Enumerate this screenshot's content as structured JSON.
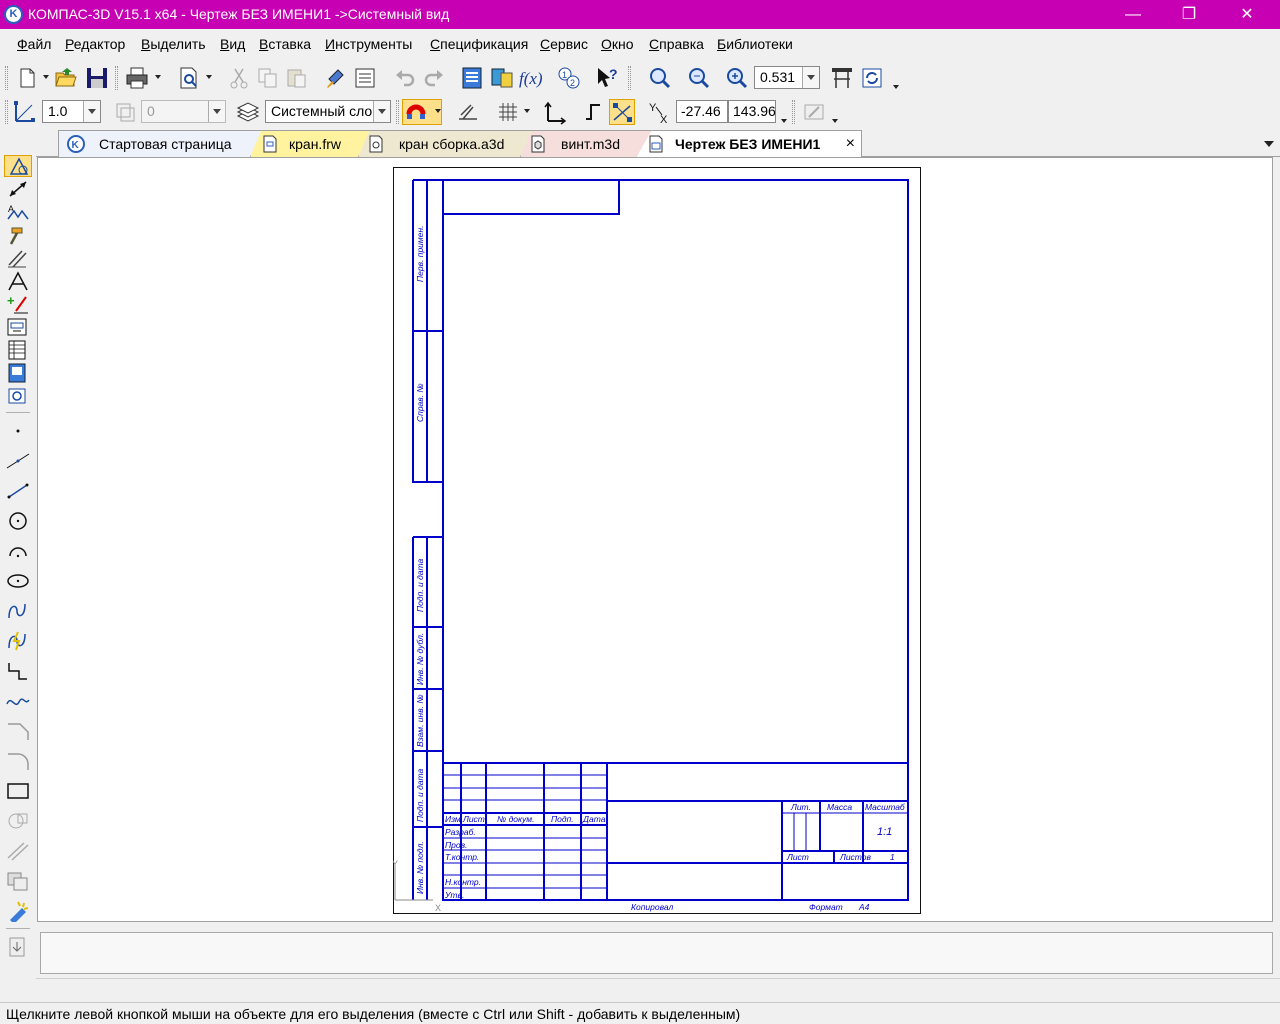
{
  "window": {
    "title": "КОМПАС-3D V15.1 x64 - Чертеж БЕЗ ИМЕНИ1 ->Системный вид",
    "app_icon_text": "K",
    "minimize_glyph": "—",
    "maximize_glyph": "❐",
    "close_glyph": "✕"
  },
  "menu": [
    "Файл",
    "Редактор",
    "Выделить",
    "Вид",
    "Вставка",
    "Инструменты",
    "Спецификация",
    "Сервис",
    "Окно",
    "Справка",
    "Библиотеки"
  ],
  "toolbar_main": {
    "zoom_value": "0.531"
  },
  "toolbar_props": {
    "line_scale": "1.0",
    "layer_number": "0",
    "layer_name": "Системный сло",
    "coord_x": "-27.46",
    "coord_y": "143.96",
    "axis_label_y": "Y",
    "axis_label_x": "X"
  },
  "tabs": [
    {
      "label": "Стартовая страница",
      "icon": "kompas-logo-icon",
      "kind": "start"
    },
    {
      "label": "кран.frw",
      "icon": "fragment-icon",
      "kind": "frw"
    },
    {
      "label": "кран сборка.a3d",
      "icon": "assembly-icon",
      "kind": "a3d"
    },
    {
      "label": "винт.m3d",
      "icon": "part-icon",
      "kind": "m3d"
    },
    {
      "label": "Чертеж БЕЗ ИМЕНИ1",
      "icon": "drawing-icon",
      "kind": "active",
      "close": "×"
    }
  ],
  "drawing": {
    "side_labels": [
      "Перв. примен.",
      "Справ. №",
      "Подп. и дата",
      "Инв. № дубл.",
      "Взам. инв. №",
      "Подп. и дата",
      "Инв. № подл."
    ],
    "title_block": {
      "col_headers": [
        "Изм",
        "Лист",
        "№ докум.",
        "Подп.",
        "Дата"
      ],
      "row_labels": [
        "Разраб.",
        "Пров.",
        "Т.контр.",
        "Н.контр.",
        "Утв."
      ],
      "lit": "Лит.",
      "massa": "Масса",
      "masshtab": "Масштаб",
      "scale_value": "1:1",
      "list": "Лист",
      "listov": "Листов",
      "listov_value": "1"
    },
    "kopiroval": "Копировал",
    "format_label": "Формат",
    "format_value": "A4",
    "origin_y": "Y",
    "origin_x": "X"
  },
  "status": "Щелкните левой кнопкой мыши на объекте для его выделения (вместе с Ctrl или Shift - добавить к выделенным)"
}
